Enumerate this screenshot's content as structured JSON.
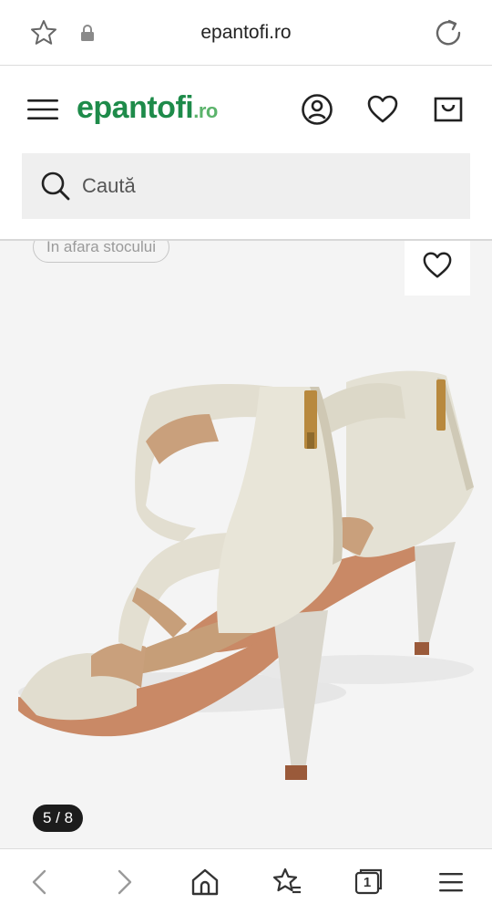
{
  "browser": {
    "url": "epantofi.ro",
    "icons": [
      "star-icon",
      "lock-icon",
      "reload-icon"
    ]
  },
  "header": {
    "logo_main": "epantofi",
    "logo_suffix": ".ro",
    "brand_color": "#1e8b4a",
    "icons": [
      "menu-icon",
      "account-icon",
      "wishlist-icon",
      "cart-icon"
    ]
  },
  "search": {
    "placeholder": "Caută"
  },
  "product": {
    "stock_badge": "În afara stocului",
    "image_counter": "5 / 8"
  },
  "bottom_nav": {
    "tab_count": "1",
    "icons": [
      "back-icon",
      "forward-icon",
      "home-icon",
      "favorites-icon",
      "tabs-icon",
      "menu-icon"
    ]
  }
}
